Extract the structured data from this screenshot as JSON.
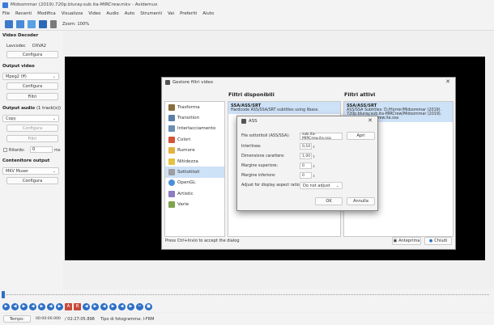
{
  "window": {
    "title": "Midsommar (2019).720p.bluray.sub.ita-MIRCrew.mkv - Avidemux"
  },
  "menu": [
    "File",
    "Recenti",
    "Modifica",
    "Visualizza",
    "Video",
    "Audio",
    "Auto",
    "Strumenti",
    "Vai",
    "Preferiti",
    "Aiuto"
  ],
  "toolbar": {
    "zoom": "Zoom: 100%"
  },
  "left": {
    "video_decoder": {
      "title": "Video Decoder",
      "label": "Lavcodec",
      "value": "DXVA2",
      "configure": "Configura"
    },
    "video_output": {
      "title": "Output video",
      "codec": "Mpeg2 (ff)",
      "configure": "Configura",
      "filters": "Filtri"
    },
    "audio_output": {
      "title": "Output audio",
      "tracks": "(1 track(s))",
      "codec": "Copy",
      "configure": "Configura",
      "filters": "Filtri",
      "delay_label": "Ritardo:",
      "delay_value": "0",
      "delay_unit": "ms"
    },
    "container": {
      "title": "Contenitore output",
      "format": "MKV Muxer",
      "configure": "Configura"
    }
  },
  "filters_dialog": {
    "title": "Gestore filtri video",
    "available_header": "Filtri disponibili",
    "active_header": "Filtri attivi",
    "categories": [
      "Trasforma",
      "Transition",
      "Interlacciamento",
      "Colori",
      "Rumore",
      "Nitidezza",
      "Sottotitoli",
      "OpenGL",
      "Artistic",
      "Varie"
    ],
    "selected_category": 6,
    "available_item": {
      "name": "SSA/ASS/SRT",
      "desc": "Hardcode ASS/SSA/SRT subtitles using libass."
    },
    "active_item": {
      "name": "SSA/ASS/SRT",
      "line1": "ASS/SSA Subtitles: D:/Horror/Midsommar (2019).",
      "line2": "720p.bluray.sub.ita-MIRCrew/Midsommar (2019).",
      "line3": "ray.sub.ita-MIRCrew.ita.ssa"
    },
    "status": "Press Ctrl+Invio to accept the dialog",
    "preview": "Anteprima",
    "close": "Chiudi"
  },
  "ass_dialog": {
    "title": "ASS",
    "file_label": "File sottotitoli (ASS/SSA):",
    "file_value": "sub.ita-MIRCrew.ita.ssa",
    "open": "Apri",
    "line_spacing_label": "Interlinea:",
    "line_spacing_value": "0,10",
    "font_size_label": "Dimensione carattere:",
    "font_size_value": "1,00",
    "top_margin_label": "Margine superiore:",
    "top_margin_value": "0",
    "bottom_margin_label": "Margine inferiore:",
    "bottom_margin_value": "0",
    "aspect_label": "Adjust for display aspect ratio:",
    "aspect_value": "Do not adjust",
    "ok": "OK",
    "cancel": "Annulla"
  },
  "status": {
    "time_label": "Tempo:",
    "current_time": "00:00:00.000",
    "total_time": "/ 02:27:05.898",
    "frame_type": "Tipo di fotogramma: I-FRM"
  },
  "colors": {
    "accent": "#2c6fc7",
    "video_bg": "#000000",
    "selection": "#cde1f7"
  }
}
